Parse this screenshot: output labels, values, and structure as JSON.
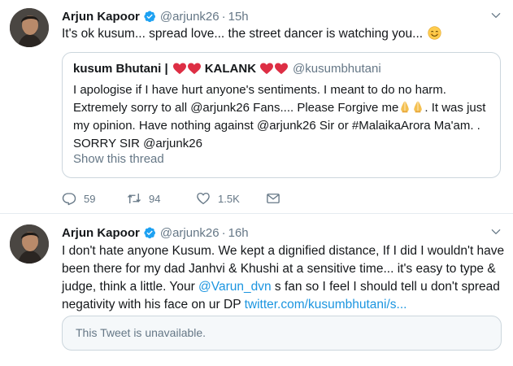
{
  "tweets": [
    {
      "name": "Arjun Kapoor",
      "handle": "@arjunk26",
      "separator": "·",
      "time": "15h",
      "text": "It's ok kusum... spread love... the street dancer is watching you...",
      "quoted": {
        "name": "kusum Bhutani |",
        "name_suffix": "KALANK",
        "handle": "@kusumbhutani",
        "line1": "I apologise if I have hurt anyone's sentiments. I meant to do no harm.",
        "line2_a": "Extremely sorry to all ",
        "line2_mention": "@arjunk26",
        "line2_b": " Fans.... Please Forgive me",
        "line2_c": ". It was just",
        "line3": "my opinion. Have nothing against @arjunk26 Sir or #MalaikaArora  Ma'am. .",
        "line4": "SORRY SIR @arjunk26",
        "show_thread": "Show this thread"
      },
      "actions": {
        "replies": "59",
        "retweets": "94",
        "likes": "1.5K"
      }
    },
    {
      "name": "Arjun Kapoor",
      "handle": "@arjunk26",
      "separator": "·",
      "time": "16h",
      "line1": "I don't hate anyone Kusum. We kept a dignified distance, If I did I wouldn't have",
      "line2": "been there for my dad Janhvi & Khushi at a sensitive time... it's easy to type &",
      "line3_a": "judge, think a little. Your ",
      "line3_mention": "@Varun_dvn",
      "line3_b": " s fan so I feel I should tell u don't spread",
      "line4_a": "negativity with his face on ur DP ",
      "line4_link": "twitter.com/kusumbhutani/s...",
      "unavailable": "This Tweet is unavailable."
    }
  ],
  "icons": {
    "verified": "verified-badge-icon",
    "caret": "chevron-down-icon",
    "reply": "reply-icon",
    "retweet": "retweet-icon",
    "like": "heart-icon",
    "message": "direct-message-icon",
    "smile": "smiling-face-emoji",
    "heart": "red-heart-emoji",
    "pray": "folded-hands-emoji"
  },
  "colors": {
    "link": "#1b95e0",
    "verified": "#1da1f2",
    "muted": "#657786",
    "border": "#ccd6dd",
    "text": "#14171a"
  }
}
